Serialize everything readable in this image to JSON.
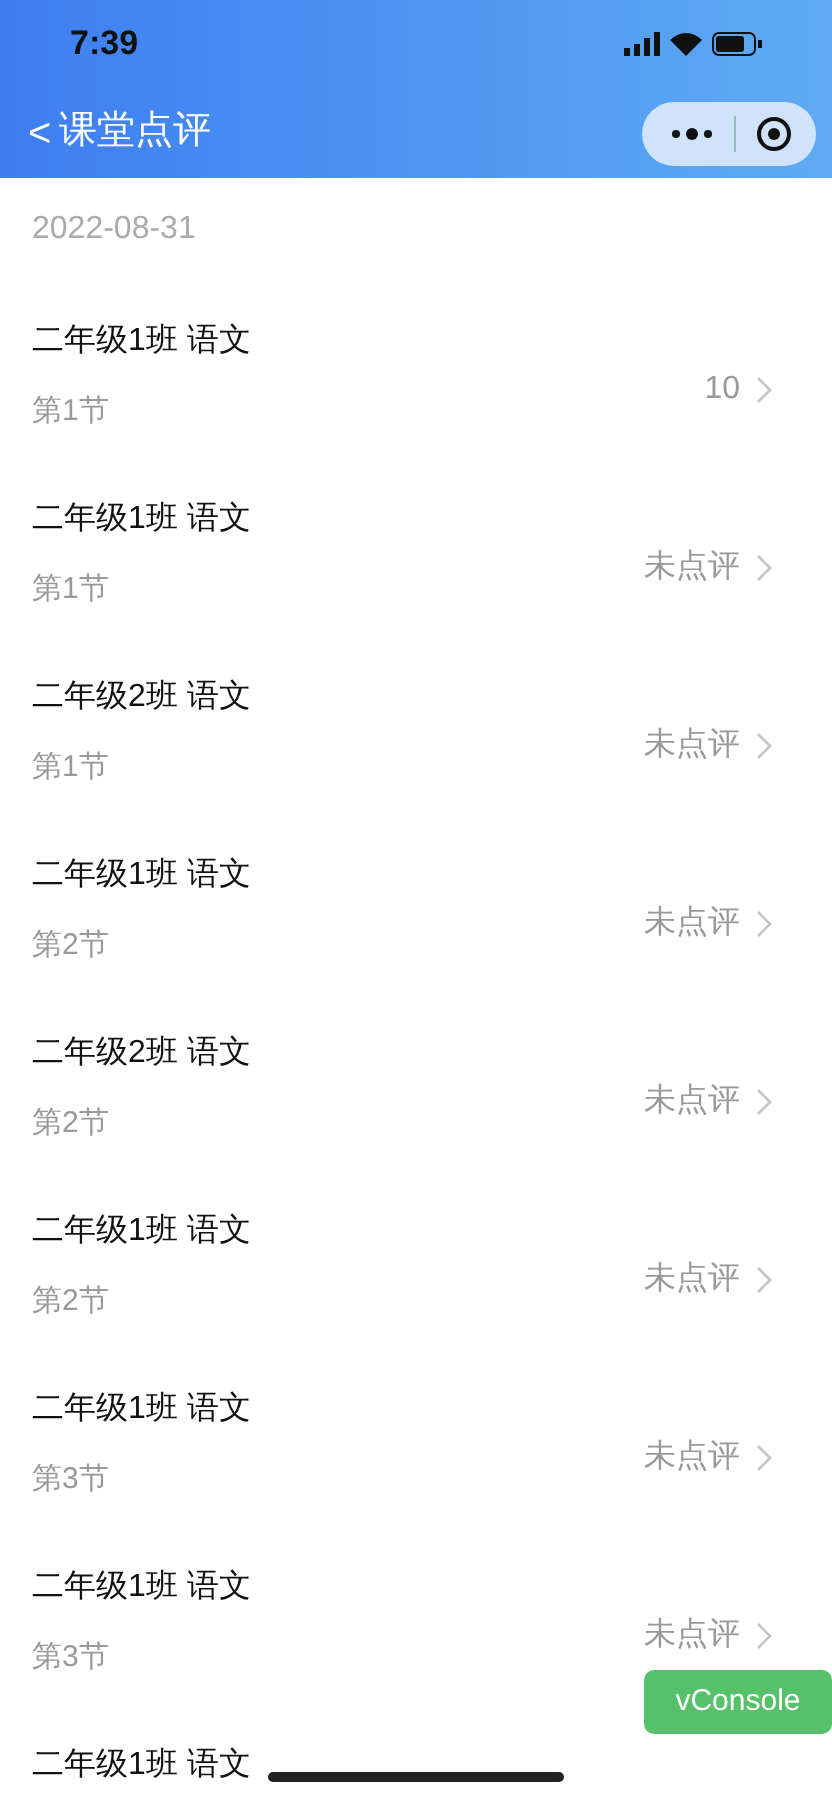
{
  "status_bar": {
    "time": "7:39"
  },
  "nav": {
    "back": "<",
    "title": "课堂点评"
  },
  "date": "2022-08-31",
  "lessons": [
    {
      "title": "二年级1班 语文",
      "period": "第1节",
      "result": "10"
    },
    {
      "title": "二年级1班 语文",
      "period": "第1节",
      "result": "未点评"
    },
    {
      "title": "二年级2班 语文",
      "period": "第1节",
      "result": "未点评"
    },
    {
      "title": "二年级1班 语文",
      "period": "第2节",
      "result": "未点评"
    },
    {
      "title": "二年级2班 语文",
      "period": "第2节",
      "result": "未点评"
    },
    {
      "title": "二年级1班 语文",
      "period": "第2节",
      "result": "未点评"
    },
    {
      "title": "二年级1班 语文",
      "period": "第3节",
      "result": "未点评"
    },
    {
      "title": "二年级1班 语文",
      "period": "第3节",
      "result": "未点评"
    },
    {
      "title": "二年级1班 语文"
    }
  ],
  "vconsole": "vConsole"
}
